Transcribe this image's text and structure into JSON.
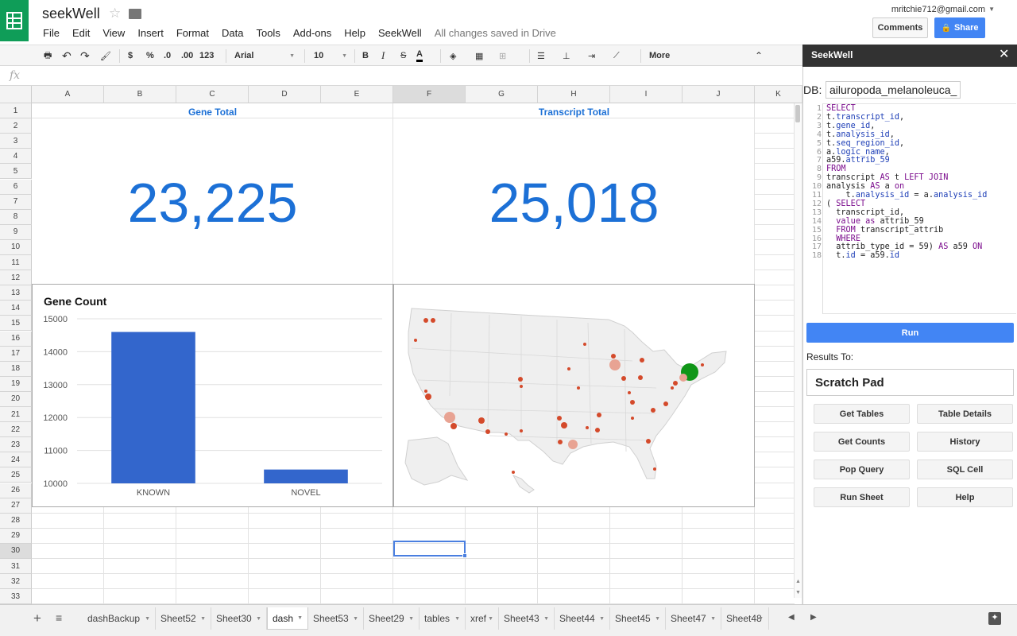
{
  "app": {
    "title": "seekWell",
    "saved_status": "All changes saved in Drive",
    "user_email": "mritchie712@gmail.com",
    "comments_label": "Comments",
    "share_label": "Share"
  },
  "menu": [
    "File",
    "Edit",
    "View",
    "Insert",
    "Format",
    "Data",
    "Tools",
    "Add-ons",
    "Help",
    "SeekWell"
  ],
  "toolbar": {
    "currency": "$",
    "percent": "%",
    "dec_less": ".0",
    "dec_more": ".00",
    "format_more": "123",
    "font": "Arial",
    "font_size": "10",
    "bold": "B",
    "italic": "I",
    "strike": "S",
    "text_color": "A",
    "more": "More"
  },
  "formula_icon": "fx",
  "columns": [
    "A",
    "B",
    "C",
    "D",
    "E",
    "F",
    "G",
    "H",
    "I",
    "J",
    "K"
  ],
  "rows": [
    "1",
    "2",
    "3",
    "4",
    "5",
    "6",
    "7",
    "8",
    "9",
    "10",
    "11",
    "12",
    "13",
    "14",
    "15",
    "16",
    "17",
    "18",
    "19",
    "20",
    "21",
    "22",
    "23",
    "24",
    "25",
    "26",
    "27",
    "28",
    "29",
    "30",
    "31",
    "32",
    "33"
  ],
  "dashboard": {
    "gene_total_label": "Gene Total",
    "gene_total_value": "23,225",
    "transcript_total_label": "Transcript Total",
    "transcript_total_value": "25,018"
  },
  "chart_data": {
    "type": "bar",
    "title": "Gene Count",
    "categories": [
      "KNOWN",
      "NOVEL"
    ],
    "values": [
      14600,
      10420
    ],
    "ylim": [
      10000,
      15000
    ],
    "yticks": [
      10000,
      11000,
      12000,
      13000,
      14000,
      15000
    ],
    "grid": true,
    "color": "#3366cc"
  },
  "map": {
    "colors": {
      "land": "#efefef",
      "border": "#d8d8d8",
      "marker": "#d44a2b",
      "marker_light": "#e8a393",
      "marker_big": "#109618"
    }
  },
  "sheet_tabs": [
    "dashBackup",
    "Sheet52",
    "Sheet30",
    "dash",
    "Sheet53",
    "Sheet29",
    "tables",
    "xref",
    "Sheet43",
    "Sheet44",
    "Sheet45",
    "Sheet47",
    "Sheet48"
  ],
  "active_tab": "dash",
  "panel": {
    "title": "SeekWell",
    "db_label": "DB:",
    "db_value": "ailuropoda_melanoleuca_",
    "code": [
      [
        [
          "kw",
          "SELECT"
        ]
      ],
      [
        [
          "",
          "t."
        ],
        [
          "fld",
          "transcript_id"
        ],
        [
          "",
          ","
        ]
      ],
      [
        [
          "",
          "t."
        ],
        [
          "fld",
          "gene_id"
        ],
        [
          "",
          ","
        ]
      ],
      [
        [
          "",
          "t."
        ],
        [
          "fld",
          "analysis_id"
        ],
        [
          "",
          ","
        ]
      ],
      [
        [
          "",
          "t."
        ],
        [
          "fld",
          "seq_region_id"
        ],
        [
          "",
          ","
        ]
      ],
      [
        [
          "",
          "a."
        ],
        [
          "fld",
          "logic_name"
        ],
        [
          "",
          ","
        ]
      ],
      [
        [
          "",
          "a59."
        ],
        [
          "fld",
          "attrib_59"
        ]
      ],
      [
        [
          "kw",
          "FROM"
        ]
      ],
      [
        [
          "",
          "transcript "
        ],
        [
          "kw",
          "AS"
        ],
        [
          "",
          " t "
        ],
        [
          "kw",
          "LEFT JOIN"
        ]
      ],
      [
        [
          "",
          "analysis "
        ],
        [
          "kw",
          "AS"
        ],
        [
          "",
          " a "
        ],
        [
          "kw",
          "on"
        ]
      ],
      [
        [
          "",
          "    t."
        ],
        [
          "fld",
          "analysis_id"
        ],
        [
          "",
          " = a."
        ],
        [
          "fld",
          "analysis_id"
        ]
      ],
      [
        [
          "",
          "( "
        ],
        [
          "kw",
          "SELECT"
        ]
      ],
      [
        [
          "",
          "  transcript_id,"
        ]
      ],
      [
        [
          "",
          "  "
        ],
        [
          "kw",
          "value"
        ],
        [
          "",
          " "
        ],
        [
          "kw",
          "as"
        ],
        [
          "",
          " attrib_59"
        ]
      ],
      [
        [
          "",
          "  "
        ],
        [
          "kw",
          "FROM"
        ],
        [
          "",
          " transcript_attrib"
        ]
      ],
      [
        [
          "",
          "  "
        ],
        [
          "kw",
          "WHERE"
        ]
      ],
      [
        [
          "",
          "  attrib_type_id = 59) "
        ],
        [
          "kw",
          "AS"
        ],
        [
          "",
          " a59 "
        ],
        [
          "kw",
          "ON"
        ]
      ],
      [
        [
          "",
          "  t."
        ],
        [
          "fld",
          "id"
        ],
        [
          "",
          " = a59."
        ],
        [
          "fld",
          "id"
        ]
      ]
    ],
    "run_label": "Run",
    "results_label": "Results To:",
    "results_value": "Scratch Pad",
    "buttons": [
      "Get Tables",
      "Table Details",
      "Get Counts",
      "History",
      "Pop Query",
      "SQL Cell",
      "Run Sheet",
      "Help"
    ]
  }
}
